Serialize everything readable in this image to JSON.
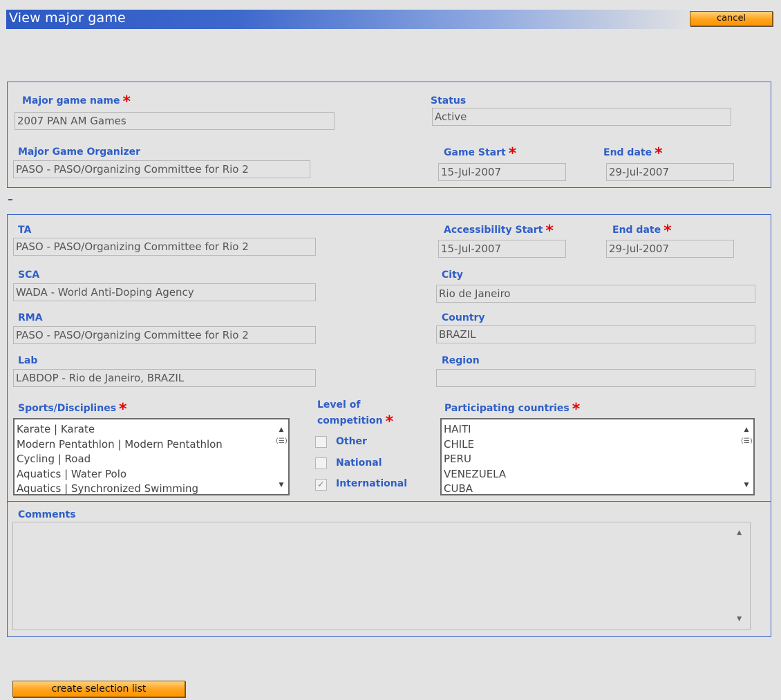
{
  "header": {
    "title": "View major game",
    "cancel_label": "cancel"
  },
  "game": {
    "name_label": "Major game name",
    "name_value": "2007 PAN AM Games",
    "status_label": "Status",
    "status_value": "Active",
    "organizer_label": "Major Game Organizer",
    "organizer_value": "PASO - PASO/Organizing Committee for Rio 2",
    "start_label": "Game Start",
    "start_value": "15-Jul-2007",
    "end_label": "End date",
    "end_value": "29-Jul-2007"
  },
  "collapse_marker": "-",
  "details": {
    "ta_label": "TA",
    "ta_value": "PASO - PASO/Organizing Committee for Rio 2",
    "access_start_label": "Accessibility Start",
    "access_start_value": "15-Jul-2007",
    "access_end_label": "End date",
    "access_end_value": "29-Jul-2007",
    "sca_label": "SCA",
    "sca_value": "WADA - World Anti-Doping Agency",
    "city_label": "City",
    "city_value": "Rio de Janeiro",
    "rma_label": "RMA",
    "rma_value": "PASO - PASO/Organizing Committee for Rio 2",
    "country_label": "Country",
    "country_value": "BRAZIL",
    "lab_label": "Lab",
    "lab_value": "LABDOP - Rio de Janeiro, BRAZIL",
    "region_label": "Region",
    "region_value": "",
    "sports_label": "Sports/Disciplines",
    "sports": [
      "Karate | Karate",
      "Modern Pentathlon | Modern Pentathlon",
      "Cycling | Road",
      "Aquatics | Water Polo",
      "Aquatics | Synchronized Swimming"
    ],
    "level_label_line1": "Level of",
    "level_label_line2": "competition",
    "levels": [
      {
        "label": "Other",
        "checked": false
      },
      {
        "label": "National",
        "checked": false
      },
      {
        "label": "International",
        "checked": true
      }
    ],
    "countries_label": "Participating countries",
    "countries": [
      "HAITI",
      "CHILE",
      "PERU",
      "VENEZUELA",
      "CUBA"
    ]
  },
  "comments": {
    "label": "Comments",
    "value": ""
  },
  "footer": {
    "create_label": "create selection list"
  },
  "colors": {
    "accent": "#2e5ec7",
    "required": "#e00000",
    "button": "#ffa21c"
  }
}
